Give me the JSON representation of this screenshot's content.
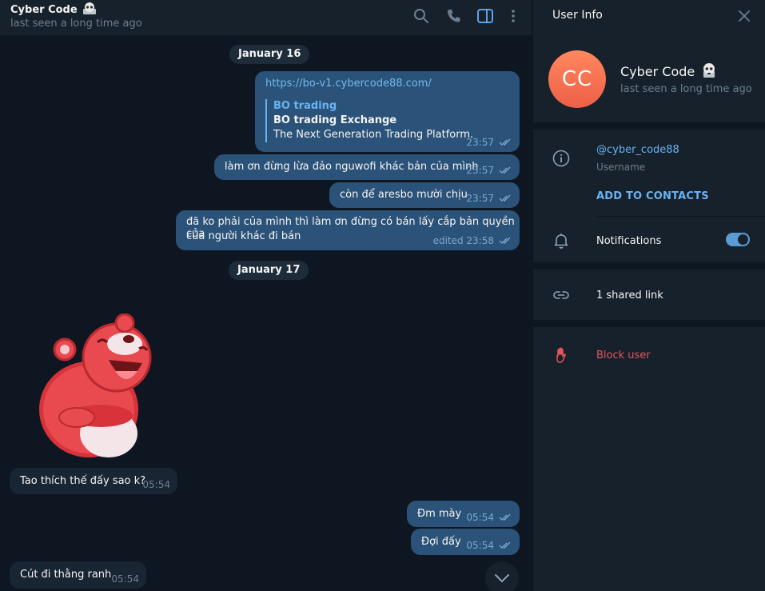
{
  "chat": {
    "title": "Cyber Code",
    "status": "last seen a long time ago"
  },
  "header_icons": [
    "search-icon",
    "phone-icon",
    "sidebar-toggle-icon",
    "more-vertical-icon"
  ],
  "messages": {
    "date1": "January 16",
    "m1": {
      "url": "https://bo-v1.cybercode88.com/",
      "preview_site": "BO trading",
      "preview_title": "BO trading Exchange",
      "preview_desc": "The Next Generation Trading Platform.",
      "time": "23:57"
    },
    "m2": {
      "text": "làm ơn đừng lừa đảo nguwofi khác bản của mình",
      "time": "23:57"
    },
    "m3": {
      "text": "còn để aresbo mười chịu",
      "time": "23:57"
    },
    "m4": {
      "line1": "đã ko phải của mình thì làm ơn đừng có bán lấy cắp bản quyền của",
      "line2": "của người khác đi bán",
      "time": "edited 23:58"
    },
    "date2": "January 17",
    "m5": {
      "text": "Tao thích thế đấy sao k?",
      "time": "05:54"
    },
    "m6": {
      "text": "Đm mày",
      "time": "05:54"
    },
    "m7": {
      "text": "Đợi đấy",
      "time": "05:54"
    },
    "m8": {
      "text": "Cút đi thằng ranh",
      "time": "05:54"
    }
  },
  "info": {
    "title": "User Info",
    "avatar_initials": "CC",
    "name": "Cyber Code",
    "status": "last seen a long time ago",
    "username": "@cyber_code88",
    "username_label": "Username",
    "add_contacts": "ADD TO CONTACTS",
    "notifications": "Notifications",
    "notifications_on": true,
    "shared_links": "1 shared link",
    "block_user": "Block user"
  },
  "colors": {
    "outgoing_bubble": "#2b5278",
    "incoming_bubble": "#182533",
    "accent": "#6ab3f3",
    "danger": "#e0565b",
    "avatar": "#f0684b"
  }
}
